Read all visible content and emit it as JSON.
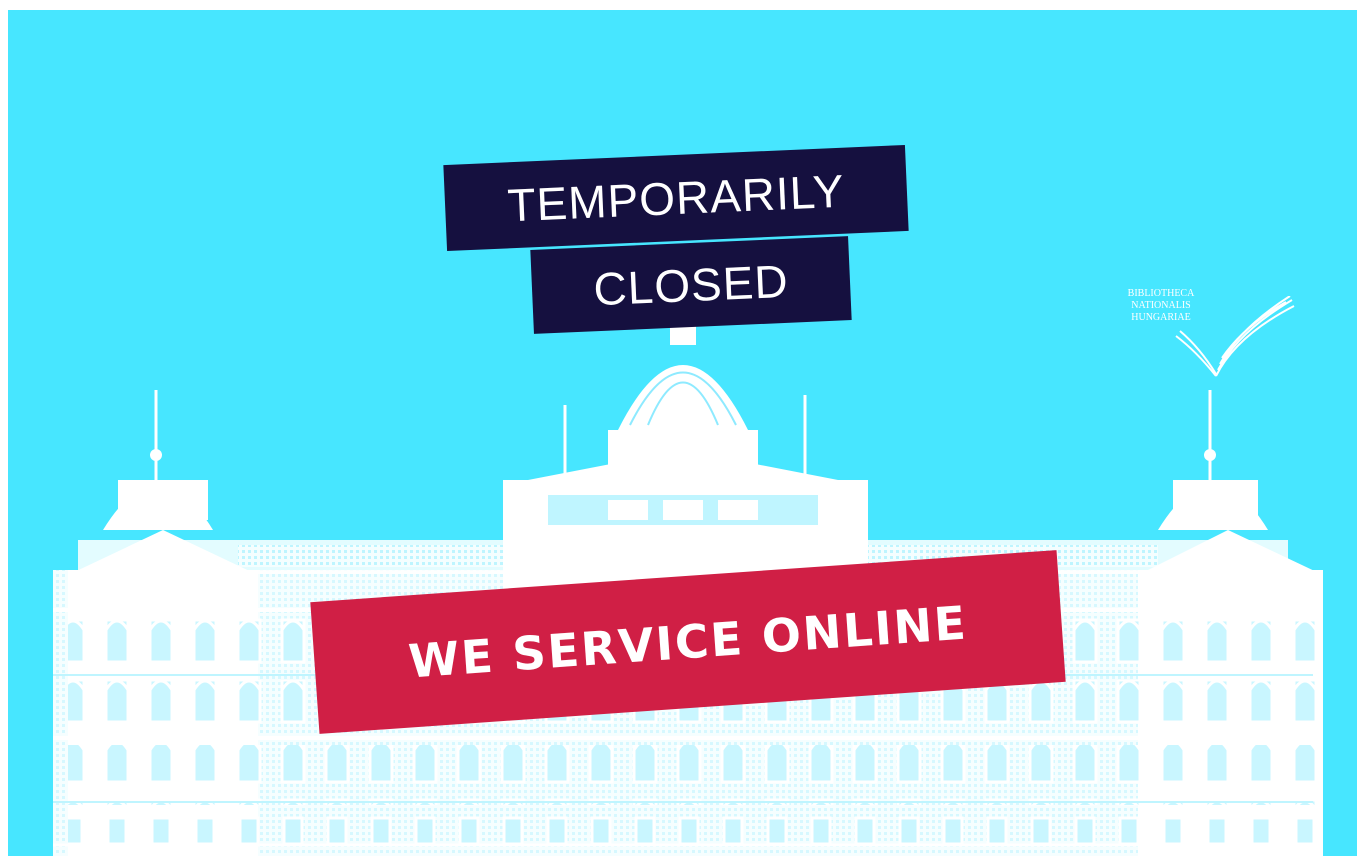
{
  "banner": {
    "title_line1": "TEMPORARILY",
    "title_line2": "CLOSED",
    "subtitle": "WE SERVICE ONLINE",
    "background_color": "#47e6ff",
    "label_color": "#15103f",
    "accent_color": "#d01f45"
  },
  "logo": {
    "line1": "BIBLIOTHECA",
    "line2": "NATIONALIS",
    "line3": "HUNGARIAE",
    "icon": "open-book-icon"
  }
}
